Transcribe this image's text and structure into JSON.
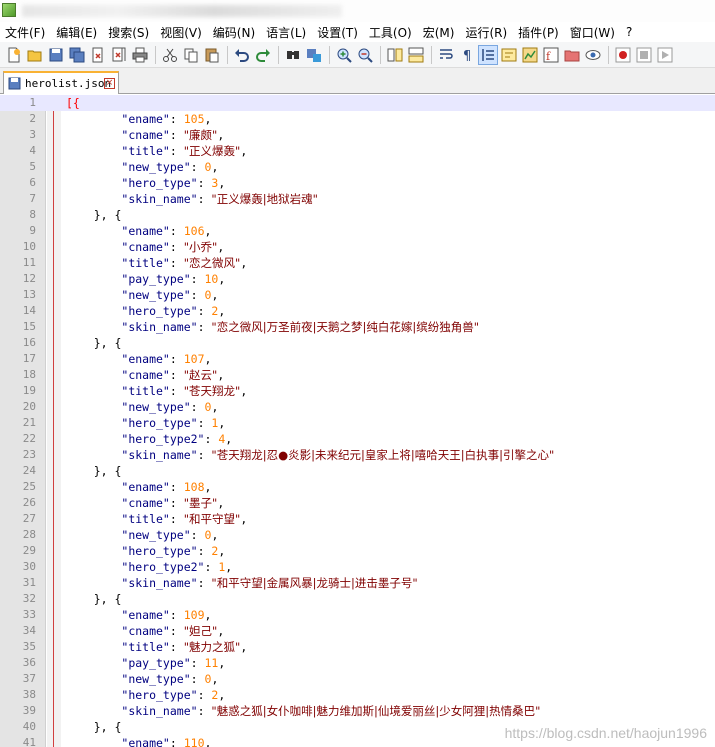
{
  "menu": [
    "文件(F)",
    "编辑(E)",
    "搜索(S)",
    "视图(V)",
    "编码(N)",
    "语言(L)",
    "设置(T)",
    "工具(O)",
    "宏(M)",
    "运行(R)",
    "插件(P)",
    "窗口(W)",
    "?"
  ],
  "tab": {
    "label": "herolist.json",
    "close": "×"
  },
  "watermark": "https://blog.csdn.net/haojun1996",
  "colors": {
    "key": "#000080",
    "string": "#800000",
    "number": "#ff8000",
    "line_highlight": "#e8e8ff"
  },
  "lines": [
    {
      "n": "1",
      "t": [
        [
          "br",
          "[{"
        ]
      ]
    },
    {
      "n": "2",
      "t": [
        [
          "p",
          "        "
        ],
        [
          "k",
          "\"ename\""
        ],
        [
          "p",
          ": "
        ],
        [
          "n",
          "105"
        ],
        [
          "p",
          ","
        ]
      ]
    },
    {
      "n": "3",
      "t": [
        [
          "p",
          "        "
        ],
        [
          "k",
          "\"cname\""
        ],
        [
          "p",
          ": "
        ],
        [
          "s",
          "\"廉颇\""
        ],
        [
          "p",
          ","
        ]
      ]
    },
    {
      "n": "4",
      "t": [
        [
          "p",
          "        "
        ],
        [
          "k",
          "\"title\""
        ],
        [
          "p",
          ": "
        ],
        [
          "s",
          "\"正义爆轰\""
        ],
        [
          "p",
          ","
        ]
      ]
    },
    {
      "n": "5",
      "t": [
        [
          "p",
          "        "
        ],
        [
          "k",
          "\"new_type\""
        ],
        [
          "p",
          ": "
        ],
        [
          "n",
          "0"
        ],
        [
          "p",
          ","
        ]
      ]
    },
    {
      "n": "6",
      "t": [
        [
          "p",
          "        "
        ],
        [
          "k",
          "\"hero_type\""
        ],
        [
          "p",
          ": "
        ],
        [
          "n",
          "3"
        ],
        [
          "p",
          ","
        ]
      ]
    },
    {
      "n": "7",
      "t": [
        [
          "p",
          "        "
        ],
        [
          "k",
          "\"skin_name\""
        ],
        [
          "p",
          ": "
        ],
        [
          "s",
          "\"正义爆轰|地狱岩魂\""
        ]
      ]
    },
    {
      "n": "8",
      "t": [
        [
          "p",
          "    }, {"
        ]
      ]
    },
    {
      "n": "9",
      "t": [
        [
          "p",
          "        "
        ],
        [
          "k",
          "\"ename\""
        ],
        [
          "p",
          ": "
        ],
        [
          "n",
          "106"
        ],
        [
          "p",
          ","
        ]
      ]
    },
    {
      "n": "10",
      "t": [
        [
          "p",
          "        "
        ],
        [
          "k",
          "\"cname\""
        ],
        [
          "p",
          ": "
        ],
        [
          "s",
          "\"小乔\""
        ],
        [
          "p",
          ","
        ]
      ]
    },
    {
      "n": "11",
      "t": [
        [
          "p",
          "        "
        ],
        [
          "k",
          "\"title\""
        ],
        [
          "p",
          ": "
        ],
        [
          "s",
          "\"恋之微风\""
        ],
        [
          "p",
          ","
        ]
      ]
    },
    {
      "n": "12",
      "t": [
        [
          "p",
          "        "
        ],
        [
          "k",
          "\"pay_type\""
        ],
        [
          "p",
          ": "
        ],
        [
          "n",
          "10"
        ],
        [
          "p",
          ","
        ]
      ]
    },
    {
      "n": "13",
      "t": [
        [
          "p",
          "        "
        ],
        [
          "k",
          "\"new_type\""
        ],
        [
          "p",
          ": "
        ],
        [
          "n",
          "0"
        ],
        [
          "p",
          ","
        ]
      ]
    },
    {
      "n": "14",
      "t": [
        [
          "p",
          "        "
        ],
        [
          "k",
          "\"hero_type\""
        ],
        [
          "p",
          ": "
        ],
        [
          "n",
          "2"
        ],
        [
          "p",
          ","
        ]
      ]
    },
    {
      "n": "15",
      "t": [
        [
          "p",
          "        "
        ],
        [
          "k",
          "\"skin_name\""
        ],
        [
          "p",
          ": "
        ],
        [
          "s",
          "\"恋之微风|万圣前夜|天鹅之梦|纯白花嫁|缤纷独角兽\""
        ]
      ]
    },
    {
      "n": "16",
      "t": [
        [
          "p",
          "    }, {"
        ]
      ]
    },
    {
      "n": "17",
      "t": [
        [
          "p",
          "        "
        ],
        [
          "k",
          "\"ename\""
        ],
        [
          "p",
          ": "
        ],
        [
          "n",
          "107"
        ],
        [
          "p",
          ","
        ]
      ]
    },
    {
      "n": "18",
      "t": [
        [
          "p",
          "        "
        ],
        [
          "k",
          "\"cname\""
        ],
        [
          "p",
          ": "
        ],
        [
          "s",
          "\"赵云\""
        ],
        [
          "p",
          ","
        ]
      ]
    },
    {
      "n": "19",
      "t": [
        [
          "p",
          "        "
        ],
        [
          "k",
          "\"title\""
        ],
        [
          "p",
          ": "
        ],
        [
          "s",
          "\"苍天翔龙\""
        ],
        [
          "p",
          ","
        ]
      ]
    },
    {
      "n": "20",
      "t": [
        [
          "p",
          "        "
        ],
        [
          "k",
          "\"new_type\""
        ],
        [
          "p",
          ": "
        ],
        [
          "n",
          "0"
        ],
        [
          "p",
          ","
        ]
      ]
    },
    {
      "n": "21",
      "t": [
        [
          "p",
          "        "
        ],
        [
          "k",
          "\"hero_type\""
        ],
        [
          "p",
          ": "
        ],
        [
          "n",
          "1"
        ],
        [
          "p",
          ","
        ]
      ]
    },
    {
      "n": "22",
      "t": [
        [
          "p",
          "        "
        ],
        [
          "k",
          "\"hero_type2\""
        ],
        [
          "p",
          ": "
        ],
        [
          "n",
          "4"
        ],
        [
          "p",
          ","
        ]
      ]
    },
    {
      "n": "23",
      "t": [
        [
          "p",
          "        "
        ],
        [
          "k",
          "\"skin_name\""
        ],
        [
          "p",
          ": "
        ],
        [
          "s",
          "\"苍天翔龙|忍●炎影|未来纪元|皇家上将|嘻哈天王|白执事|引擎之心\""
        ]
      ]
    },
    {
      "n": "24",
      "t": [
        [
          "p",
          "    }, {"
        ]
      ]
    },
    {
      "n": "25",
      "t": [
        [
          "p",
          "        "
        ],
        [
          "k",
          "\"ename\""
        ],
        [
          "p",
          ": "
        ],
        [
          "n",
          "108"
        ],
        [
          "p",
          ","
        ]
      ]
    },
    {
      "n": "26",
      "t": [
        [
          "p",
          "        "
        ],
        [
          "k",
          "\"cname\""
        ],
        [
          "p",
          ": "
        ],
        [
          "s",
          "\"墨子\""
        ],
        [
          "p",
          ","
        ]
      ]
    },
    {
      "n": "27",
      "t": [
        [
          "p",
          "        "
        ],
        [
          "k",
          "\"title\""
        ],
        [
          "p",
          ": "
        ],
        [
          "s",
          "\"和平守望\""
        ],
        [
          "p",
          ","
        ]
      ]
    },
    {
      "n": "28",
      "t": [
        [
          "p",
          "        "
        ],
        [
          "k",
          "\"new_type\""
        ],
        [
          "p",
          ": "
        ],
        [
          "n",
          "0"
        ],
        [
          "p",
          ","
        ]
      ]
    },
    {
      "n": "29",
      "t": [
        [
          "p",
          "        "
        ],
        [
          "k",
          "\"hero_type\""
        ],
        [
          "p",
          ": "
        ],
        [
          "n",
          "2"
        ],
        [
          "p",
          ","
        ]
      ]
    },
    {
      "n": "30",
      "t": [
        [
          "p",
          "        "
        ],
        [
          "k",
          "\"hero_type2\""
        ],
        [
          "p",
          ": "
        ],
        [
          "n",
          "1"
        ],
        [
          "p",
          ","
        ]
      ]
    },
    {
      "n": "31",
      "t": [
        [
          "p",
          "        "
        ],
        [
          "k",
          "\"skin_name\""
        ],
        [
          "p",
          ": "
        ],
        [
          "s",
          "\"和平守望|金属风暴|龙骑士|进击墨子号\""
        ]
      ]
    },
    {
      "n": "32",
      "t": [
        [
          "p",
          "    }, {"
        ]
      ]
    },
    {
      "n": "33",
      "t": [
        [
          "p",
          "        "
        ],
        [
          "k",
          "\"ename\""
        ],
        [
          "p",
          ": "
        ],
        [
          "n",
          "109"
        ],
        [
          "p",
          ","
        ]
      ]
    },
    {
      "n": "34",
      "t": [
        [
          "p",
          "        "
        ],
        [
          "k",
          "\"cname\""
        ],
        [
          "p",
          ": "
        ],
        [
          "s",
          "\"妲己\""
        ],
        [
          "p",
          ","
        ]
      ]
    },
    {
      "n": "35",
      "t": [
        [
          "p",
          "        "
        ],
        [
          "k",
          "\"title\""
        ],
        [
          "p",
          ": "
        ],
        [
          "s",
          "\"魅力之狐\""
        ],
        [
          "p",
          ","
        ]
      ]
    },
    {
      "n": "36",
      "t": [
        [
          "p",
          "        "
        ],
        [
          "k",
          "\"pay_type\""
        ],
        [
          "p",
          ": "
        ],
        [
          "n",
          "11"
        ],
        [
          "p",
          ","
        ]
      ]
    },
    {
      "n": "37",
      "t": [
        [
          "p",
          "        "
        ],
        [
          "k",
          "\"new_type\""
        ],
        [
          "p",
          ": "
        ],
        [
          "n",
          "0"
        ],
        [
          "p",
          ","
        ]
      ]
    },
    {
      "n": "38",
      "t": [
        [
          "p",
          "        "
        ],
        [
          "k",
          "\"hero_type\""
        ],
        [
          "p",
          ": "
        ],
        [
          "n",
          "2"
        ],
        [
          "p",
          ","
        ]
      ]
    },
    {
      "n": "39",
      "t": [
        [
          "p",
          "        "
        ],
        [
          "k",
          "\"skin_name\""
        ],
        [
          "p",
          ": "
        ],
        [
          "s",
          "\"魅惑之狐|女仆咖啡|魅力维加斯|仙境爱丽丝|少女阿狸|热情桑巴\""
        ]
      ]
    },
    {
      "n": "40",
      "t": [
        [
          "p",
          "    }, {"
        ]
      ]
    },
    {
      "n": "41",
      "t": [
        [
          "p",
          "        "
        ],
        [
          "k",
          "\"ename\""
        ],
        [
          "p",
          ": "
        ],
        [
          "n",
          "110"
        ],
        [
          "p",
          ","
        ]
      ]
    }
  ]
}
